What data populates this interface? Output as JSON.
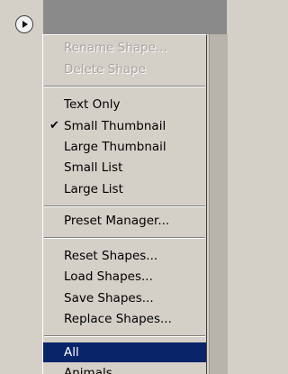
{
  "menu": {
    "disabled_items": [
      "Rename Shape...",
      "Delete Shape"
    ],
    "view_items": [
      {
        "label": "Text Only",
        "checked": false
      },
      {
        "label": "Small Thumbnail",
        "checked": true
      },
      {
        "label": "Large Thumbnail",
        "checked": false
      },
      {
        "label": "Small List",
        "checked": false
      },
      {
        "label": "Large List",
        "checked": false
      }
    ],
    "preset_manager": "Preset Manager...",
    "shape_actions": [
      "Reset Shapes...",
      "Load Shapes...",
      "Save Shapes...",
      "Replace Shapes..."
    ],
    "libraries": [
      {
        "label": "All",
        "selected": true
      },
      {
        "label": "Animals",
        "selected": false
      }
    ],
    "check_glyph": "✔"
  },
  "colors": {
    "menu_bg": "#d4d0c8",
    "highlight": "#0a246a",
    "disabled_text": "#a8a4a0"
  },
  "icons": {
    "flyout": "circle-right-arrow-icon"
  }
}
